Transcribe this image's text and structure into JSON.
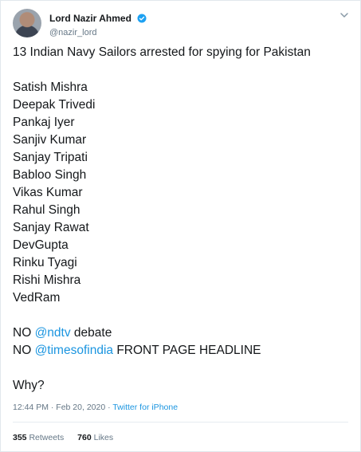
{
  "author": {
    "display_name": "Lord Nazir Ahmed",
    "handle": "@nazir_lord",
    "verified_icon": "verified-badge-icon",
    "badge_color": "#1da1f2"
  },
  "tweet": {
    "headline": "13 Indian Navy Sailors arrested for spying for Pakistan",
    "names": [
      "Satish Mishra",
      "Deepak Trivedi",
      "Pankaj Iyer",
      "Sanjiv Kumar",
      "Sanjay Tripati",
      "Babloo Singh",
      "Vikas Kumar",
      "Rahul Singh",
      "Sanjay Rawat",
      "DevGupta",
      "Rinku Tyagi",
      "Rishi Mishra",
      "VedRam"
    ],
    "line1": {
      "prefix": "NO ",
      "mention": "@ndtv",
      "suffix": " debate"
    },
    "line2": {
      "prefix": "NO ",
      "mention": "@timesofindia",
      "suffix": " FRONT PAGE HEADLINE"
    },
    "closing": "Why?"
  },
  "meta": {
    "time": "12:44 PM",
    "separator1": " · ",
    "date": "Feb 20, 2020",
    "separator2": " · ",
    "source": "Twitter for iPhone"
  },
  "stats": {
    "retweets_count": "355",
    "retweets_label": "Retweets",
    "likes_count": "760",
    "likes_label": "Likes"
  },
  "colors": {
    "link": "#1b95e0",
    "secondary_text": "#657786",
    "primary_text": "#14171a"
  }
}
